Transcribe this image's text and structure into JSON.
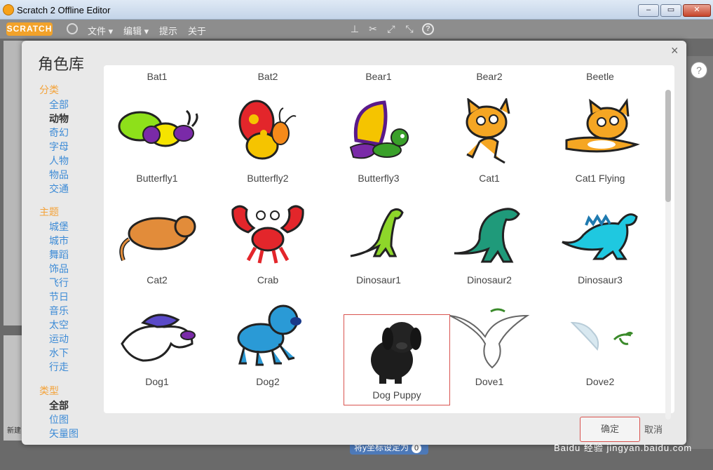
{
  "window": {
    "title": "Scratch 2 Offline Editor",
    "close_glyph": "✕"
  },
  "menubar": {
    "logo": "SCRATCH",
    "items": [
      "文件",
      "编辑",
      "提示",
      "关于"
    ],
    "tools": [
      "stamp-icon",
      "cut-icon",
      "grow-icon",
      "shrink-icon",
      "help-icon"
    ]
  },
  "dialog": {
    "title": "角色库",
    "close_label": "×",
    "category_head": "分类",
    "categories": [
      "全部",
      "动物",
      "奇幻",
      "字母",
      "人物",
      "物品",
      "交通"
    ],
    "active_category": "动物",
    "theme_head": "主题",
    "themes": [
      "城堡",
      "城市",
      "舞蹈",
      "饰品",
      "飞行",
      "节日",
      "音乐",
      "太空",
      "运动",
      "水下",
      "行走"
    ],
    "type_head": "类型",
    "types": [
      "全部",
      "位图",
      "矢量图"
    ],
    "active_type": "全部",
    "sprites": [
      "Bat1",
      "Bat2",
      "Bear1",
      "Bear2",
      "Beetle",
      "Butterfly1",
      "Butterfly2",
      "Butterfly3",
      "Cat1",
      "Cat1 Flying",
      "Cat2",
      "Crab",
      "Dinosaur1",
      "Dinosaur2",
      "Dinosaur3",
      "Dog1",
      "Dog2",
      "Dog Puppy",
      "Dove1",
      "Dove2"
    ],
    "selected_sprite": "Dog Puppy",
    "ok_label": "确定",
    "cancel_label": "取消"
  },
  "background": {
    "new_label": "新建",
    "script_block": "将y坐标设定为",
    "script_value": "0",
    "help_glyph": "?"
  },
  "watermark": "Baidu 经验 jingyan.baidu.com"
}
